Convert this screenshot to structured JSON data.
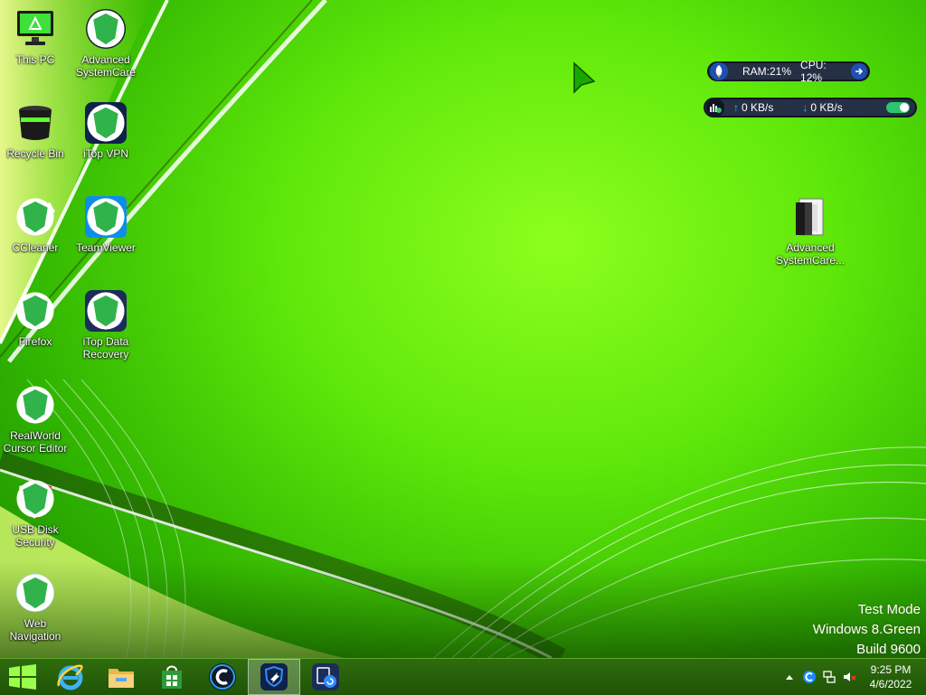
{
  "desktop": {
    "icons": [
      {
        "label": "This PC",
        "icon": "computer-icon"
      },
      {
        "label": "Advanced\nSystemCare",
        "icon": "advanced-systemcare-icon"
      },
      {
        "label": "Recycle Bin",
        "icon": "recycle-bin-icon"
      },
      {
        "label": "iTop VPN",
        "icon": "itop-vpn-icon"
      },
      {
        "label": "CCleaner",
        "icon": "ccleaner-icon"
      },
      {
        "label": "TeamViewer",
        "icon": "teamviewer-icon"
      },
      {
        "label": "Firefox",
        "icon": "firefox-icon"
      },
      {
        "label": "iTop Data\nRecovery",
        "icon": "itop-data-recovery-icon"
      },
      {
        "label": "RealWorld\nCursor Editor",
        "icon": "realworld-cursor-editor-icon"
      },
      {
        "label": "USB Disk\nSecurity",
        "icon": "usb-disk-security-icon"
      },
      {
        "label": "Web\nNavigation",
        "icon": "web-navigation-icon"
      },
      {
        "label": "Advanced\nSystemCare...",
        "icon": "archive-file-icon"
      }
    ]
  },
  "widgets": {
    "monitor": {
      "ram": "RAM:21%",
      "cpu": "CPU: 12%"
    },
    "network": {
      "up": "0 KB/s",
      "down": "0 KB/s"
    }
  },
  "watermark": {
    "line1": "Test Mode",
    "line2": "Windows 8.Green",
    "line3": "Build 9600"
  },
  "taskbar": {
    "time": "9:25 PM",
    "date": "4/6/2022",
    "buttons": [
      "start-icon",
      "internet-explorer-icon",
      "file-explorer-icon",
      "store-icon",
      "advanced-systemcare-icon",
      "itop-vpn-icon",
      "itop-data-recovery-icon"
    ]
  },
  "colors": {
    "accent_green": "#5fe80a",
    "taskbar": "#2f6c0d",
    "widget_bg": "#263044"
  }
}
